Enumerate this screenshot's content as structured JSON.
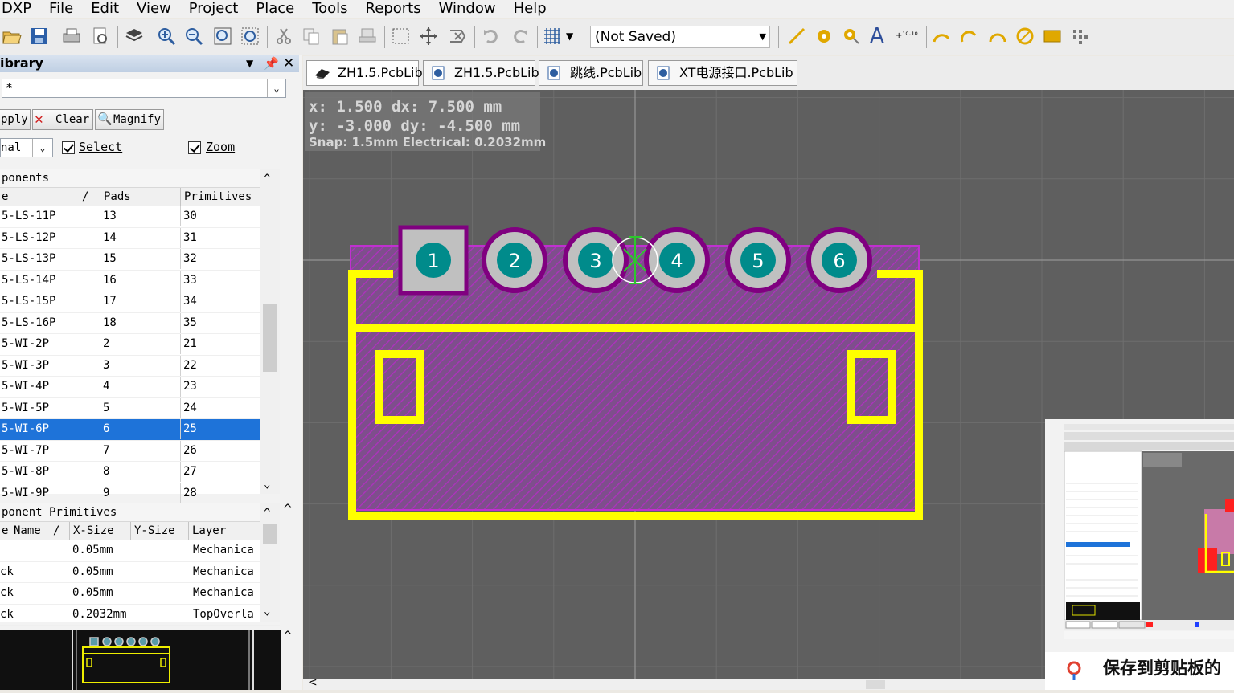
{
  "menu": [
    "DXP",
    "File",
    "Edit",
    "View",
    "Project",
    "Place",
    "Tools",
    "Reports",
    "Window",
    "Help"
  ],
  "toolbar": {
    "view_config": "(Not Saved)"
  },
  "library": {
    "title": "ibrary",
    "filter": "*",
    "buttons": {
      "apply": "pply",
      "clear": "Clear",
      "magnify": "Magnify"
    },
    "mask": "nal",
    "select_label": "Select",
    "zoom_label": "Zoom",
    "components": {
      "title": "ponents",
      "columns": [
        "e",
        "/",
        "Pads",
        "Primitives"
      ],
      "rows": [
        [
          "5-LS-11P",
          "13",
          "30"
        ],
        [
          "5-LS-12P",
          "14",
          "31"
        ],
        [
          "5-LS-13P",
          "15",
          "32"
        ],
        [
          "5-LS-14P",
          "16",
          "33"
        ],
        [
          "5-LS-15P",
          "17",
          "34"
        ],
        [
          "5-LS-16P",
          "18",
          "35"
        ],
        [
          "5-WI-2P",
          "2",
          "21"
        ],
        [
          "5-WI-3P",
          "3",
          "22"
        ],
        [
          "5-WI-4P",
          "4",
          "23"
        ],
        [
          "5-WI-5P",
          "5",
          "24"
        ],
        [
          "5-WI-6P",
          "6",
          "25"
        ],
        [
          "5-WI-7P",
          "7",
          "26"
        ],
        [
          "5-WI-8P",
          "8",
          "27"
        ],
        [
          "5-WI-9P",
          "9",
          "28"
        ]
      ],
      "selected_index": 10
    },
    "primitives": {
      "title": "ponent Primitives",
      "columns": [
        "e",
        "Name",
        "/",
        "X-Size",
        "Y-Size",
        "Layer"
      ],
      "rows": [
        [
          "",
          "",
          "0.05mm",
          "",
          "Mechanica"
        ],
        [
          "ck",
          "",
          "0.05mm",
          "",
          "Mechanica"
        ],
        [
          "ck",
          "",
          "0.05mm",
          "",
          "Mechanica"
        ],
        [
          "ck",
          "",
          "0.2032mm",
          "",
          "TopOverla"
        ]
      ]
    }
  },
  "tabs": [
    "ZH1.5.PcbLib",
    "ZH1.5.PcbLib",
    "跳线.PcbLib",
    "XT电源接口.PcbLib"
  ],
  "coords": {
    "line1": "x:  1.500    dx:  7.500  mm",
    "line2": "y: -3.000    dy: -4.500  mm",
    "line3": "Snap: 1.5mm Electrical: 0.2032mm"
  },
  "pads": [
    "1",
    "2",
    "3",
    "4",
    "5",
    "6"
  ],
  "thumbnail": {
    "caption": "保存到剪贴板的"
  },
  "colors": {
    "overlay": "#FFFF00",
    "pad_ring": "#800080",
    "pad_gray": "#C0C0C0",
    "pad_hole": "#008B8B",
    "keepout": "#A020A0",
    "canvas": "#5F5F5F"
  }
}
